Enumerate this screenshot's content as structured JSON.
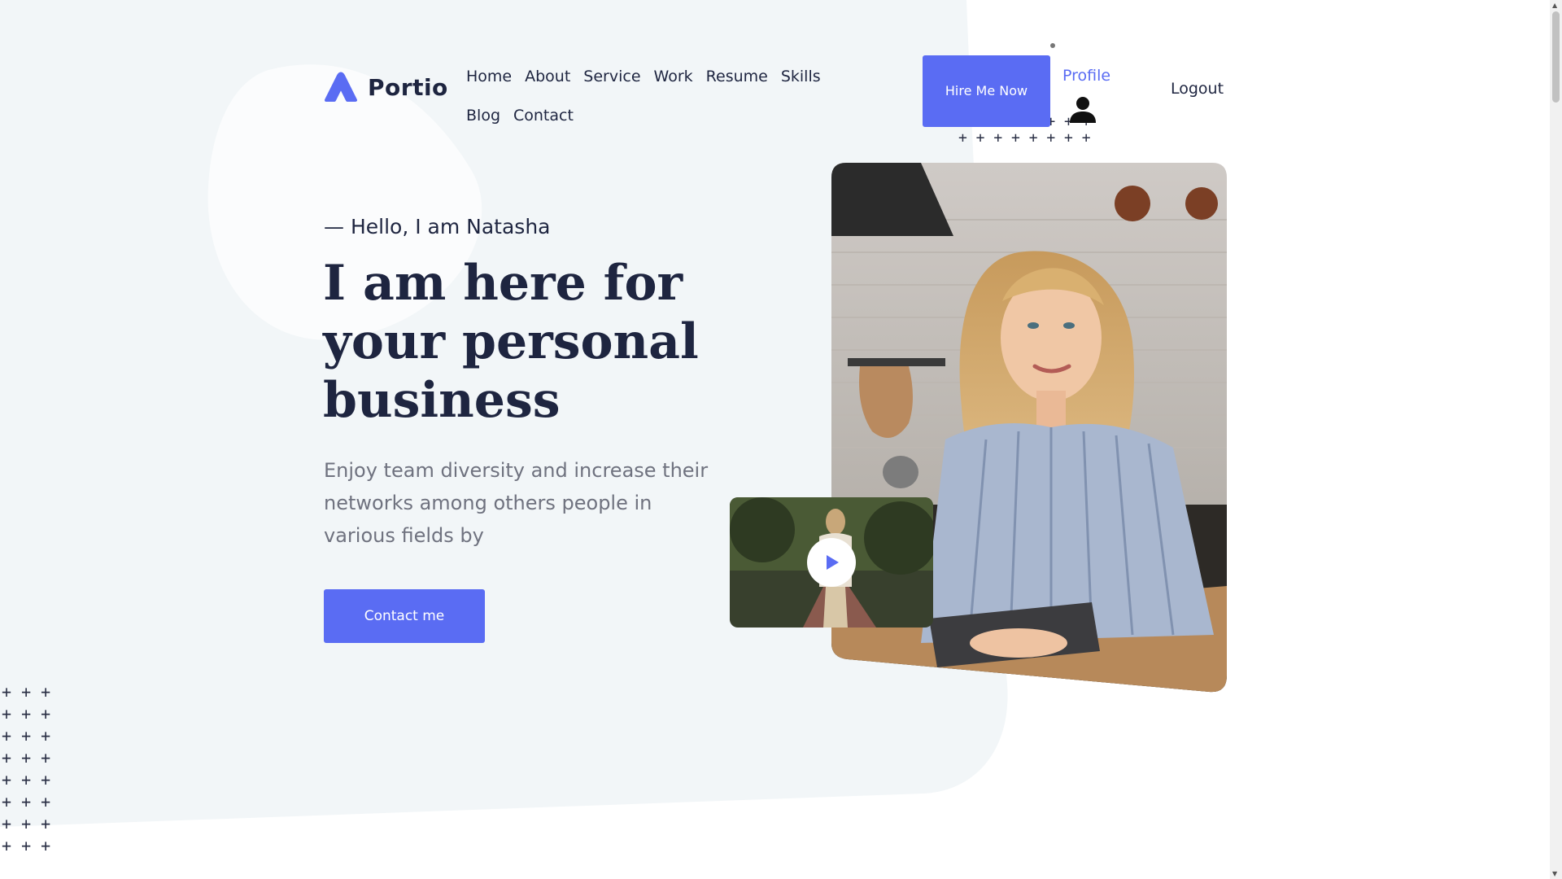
{
  "brand": {
    "name": "Portio",
    "accent": "#5a6cf3",
    "text_dark": "#1e2540"
  },
  "nav": {
    "items": [
      {
        "label": "Home"
      },
      {
        "label": "About"
      },
      {
        "label": "Service"
      },
      {
        "label": "Work"
      },
      {
        "label": "Resume"
      },
      {
        "label": "Skills"
      },
      {
        "label": "Blog"
      },
      {
        "label": "Contact"
      }
    ],
    "hire_button": "Hire Me Now",
    "profile_label": "Profile",
    "profile_icon": "user-icon",
    "logout_label": "Logout"
  },
  "hero": {
    "greeting": "— Hello, I am Natasha",
    "title": "I am here for your personal business",
    "description": "Enjoy team diversity and increase their networks among others people in various fields by",
    "cta_label": "Contact me",
    "play_icon": "play-icon"
  },
  "decor": {
    "plus_top": "+ + + + + + + +\n+ + + + + + + +",
    "plus_left": "+ + +\n+ + +\n+ + +\n+ + +\n+ + +\n+ + +\n+ + +\n+ + +"
  }
}
